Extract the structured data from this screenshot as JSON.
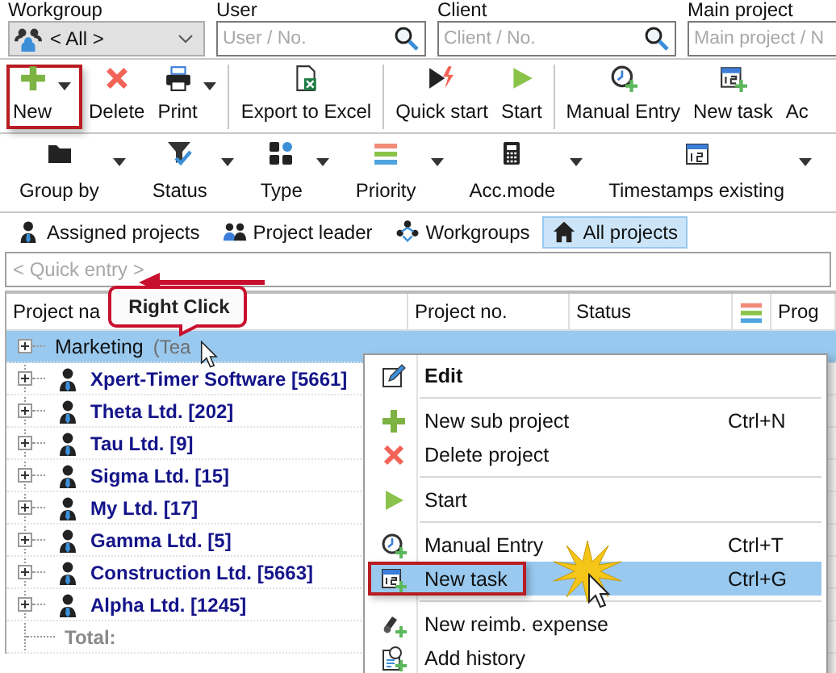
{
  "filters": [
    {
      "label": "Workgroup",
      "kind": "combo",
      "value": "< All >"
    },
    {
      "label": "User",
      "kind": "search",
      "placeholder": "User / No."
    },
    {
      "label": "Client",
      "kind": "search",
      "placeholder": "Client / No."
    },
    {
      "label": "Main project",
      "kind": "search",
      "placeholder": "Main project / N"
    }
  ],
  "toolbar": [
    [
      {
        "label": "New",
        "kind": "new",
        "dropdown": true,
        "highlighted": true
      },
      {
        "label": "Delete",
        "kind": "delete",
        "dropdown": false,
        "highlighted": false
      },
      {
        "label": "Print",
        "kind": "print",
        "dropdown": true,
        "highlighted": false
      }
    ],
    [
      {
        "label": "Export to Excel",
        "kind": "excel",
        "dropdown": false,
        "highlighted": false
      }
    ],
    [
      {
        "label": "Quick start",
        "kind": "quickstart",
        "dropdown": false,
        "highlighted": false
      },
      {
        "label": "Start",
        "kind": "start",
        "dropdown": false,
        "highlighted": false
      }
    ],
    [
      {
        "label": "Manual Entry",
        "kind": "manual",
        "dropdown": false,
        "highlighted": false
      },
      {
        "label": "New task",
        "kind": "task",
        "dropdown": false,
        "highlighted": false
      },
      {
        "label": "Ac",
        "kind": "cut",
        "dropdown": false,
        "highlighted": false
      }
    ]
  ],
  "filter_bar": [
    {
      "label": "Group by",
      "kind": "folder"
    },
    {
      "label": "Status",
      "kind": "status"
    },
    {
      "label": "Type",
      "kind": "type"
    },
    {
      "label": "Priority",
      "kind": "priority"
    },
    {
      "label": "Acc.mode",
      "kind": "accmode"
    },
    {
      "label": "Timestamps existing",
      "kind": "timestamps"
    }
  ],
  "tabs": [
    {
      "label": "Assigned projects",
      "kind": "person",
      "selected": false
    },
    {
      "label": "Project leader",
      "kind": "leader",
      "selected": false
    },
    {
      "label": "Workgroups",
      "kind": "workgroup",
      "selected": false
    },
    {
      "label": "All projects",
      "kind": "home",
      "selected": true
    }
  ],
  "quick_entry": {
    "placeholder": "< Quick entry >"
  },
  "table": {
    "columns": [
      {
        "kind": "text",
        "label": "Project na"
      },
      {
        "kind": "text",
        "label": "Project no."
      },
      {
        "kind": "text",
        "label": "Status"
      },
      {
        "kind": "priority"
      },
      {
        "kind": "text",
        "label": "Prog"
      }
    ],
    "rows": [
      {
        "kind": "team",
        "name": "Marketing",
        "note": "(Tea",
        "selected": true
      },
      {
        "kind": "client",
        "name": "Xpert-Timer Software [5661]",
        "selected": false
      },
      {
        "kind": "client",
        "name": "Theta Ltd. [202]",
        "selected": false
      },
      {
        "kind": "client",
        "name": "Tau Ltd. [9]",
        "selected": false
      },
      {
        "kind": "client",
        "name": "Sigma Ltd. [15]",
        "selected": false
      },
      {
        "kind": "client",
        "name": "My Ltd. [17]",
        "selected": false
      },
      {
        "kind": "client",
        "name": "Gamma Ltd. [5]",
        "selected": false
      },
      {
        "kind": "client",
        "name": "Construction Ltd. [5663]",
        "selected": false
      },
      {
        "kind": "client",
        "name": "Alpha Ltd. [1245]",
        "selected": false
      }
    ],
    "total": "Total:"
  },
  "context_menu": {
    "groups": [
      [
        {
          "kind": "edit",
          "label": "Edit",
          "default": true,
          "selected": false,
          "highlighted": false
        }
      ],
      [
        {
          "kind": "new",
          "label": "New sub project",
          "shortcut": "Ctrl+N",
          "default": false,
          "selected": false,
          "highlighted": false
        },
        {
          "kind": "delete",
          "label": "Delete project",
          "default": false,
          "selected": false,
          "highlighted": false
        }
      ],
      [
        {
          "kind": "start",
          "label": "Start",
          "default": false,
          "selected": false,
          "highlighted": false
        }
      ],
      [
        {
          "kind": "manual",
          "label": "Manual Entry",
          "shortcut": "Ctrl+T",
          "default": false,
          "selected": false,
          "highlighted": false
        },
        {
          "kind": "task",
          "label": "New task",
          "shortcut": "Ctrl+G",
          "default": false,
          "selected": true,
          "highlighted": true
        }
      ],
      [
        {
          "kind": "expense",
          "label": "New reimb. expense",
          "default": false,
          "selected": false,
          "highlighted": false
        },
        {
          "kind": "history",
          "label": "Add history",
          "default": false,
          "selected": false,
          "highlighted": false
        }
      ]
    ]
  },
  "callout": {
    "text": "Right Click"
  }
}
